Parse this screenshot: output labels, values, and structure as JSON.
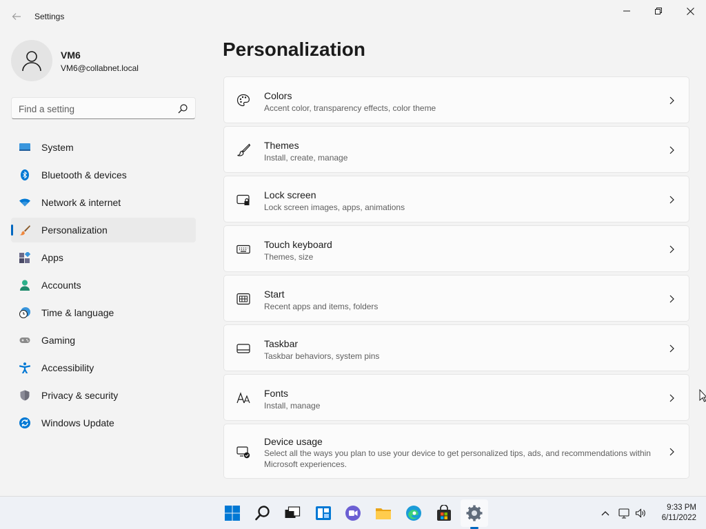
{
  "window": {
    "title": "Settings"
  },
  "profile": {
    "name": "VM6",
    "email": "VM6@collabnet.local"
  },
  "search": {
    "placeholder": "Find a setting"
  },
  "sidebar": {
    "items": [
      {
        "label": "System",
        "icon": "system-icon"
      },
      {
        "label": "Bluetooth & devices",
        "icon": "bluetooth-icon"
      },
      {
        "label": "Network & internet",
        "icon": "wifi-icon"
      },
      {
        "label": "Personalization",
        "icon": "brush-icon",
        "selected": true
      },
      {
        "label": "Apps",
        "icon": "apps-icon"
      },
      {
        "label": "Accounts",
        "icon": "accounts-icon"
      },
      {
        "label": "Time & language",
        "icon": "clock-globe-icon"
      },
      {
        "label": "Gaming",
        "icon": "gamepad-icon"
      },
      {
        "label": "Accessibility",
        "icon": "accessibility-icon"
      },
      {
        "label": "Privacy & security",
        "icon": "shield-icon"
      },
      {
        "label": "Windows Update",
        "icon": "update-icon"
      }
    ]
  },
  "main": {
    "title": "Personalization",
    "cards": [
      {
        "title": "Colors",
        "subtitle": "Accent color, transparency effects, color theme",
        "icon": "palette-icon"
      },
      {
        "title": "Themes",
        "subtitle": "Install, create, manage",
        "icon": "brush-icon"
      },
      {
        "title": "Lock screen",
        "subtitle": "Lock screen images, apps, animations",
        "icon": "lock-screen-icon"
      },
      {
        "title": "Touch keyboard",
        "subtitle": "Themes, size",
        "icon": "keyboard-icon"
      },
      {
        "title": "Start",
        "subtitle": "Recent apps and items, folders",
        "icon": "start-icon"
      },
      {
        "title": "Taskbar",
        "subtitle": "Taskbar behaviors, system pins",
        "icon": "taskbar-icon"
      },
      {
        "title": "Fonts",
        "subtitle": "Install, manage",
        "icon": "fonts-icon"
      },
      {
        "title": "Device usage",
        "subtitle": "Select all the ways you plan to use your device to get personalized tips, ads, and recommendations within Microsoft experiences.",
        "icon": "device-usage-icon"
      }
    ]
  },
  "taskbar": {
    "apps": [
      "start-icon",
      "search-icon",
      "task-view-icon",
      "widgets-icon",
      "chat-icon",
      "file-explorer-icon",
      "edge-icon",
      "store-icon",
      "settings-icon"
    ],
    "clock": {
      "time": "9:33 PM",
      "date": "6/11/2022"
    }
  },
  "colors": {
    "accent": "#0067c0",
    "background": "#f3f3f3",
    "card": "#fbfbfb"
  }
}
